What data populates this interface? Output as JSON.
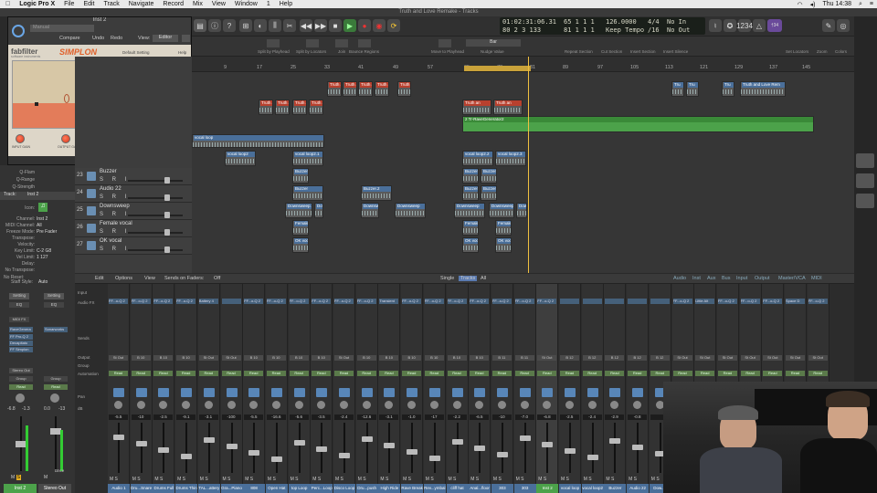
{
  "menubar": {
    "app_name": "Logic Pro X",
    "items": [
      "File",
      "Edit",
      "Track",
      "Navigate",
      "Record",
      "Mix",
      "View",
      "Window",
      "1",
      "Help"
    ],
    "clock": "Thu 14:38"
  },
  "window_title": "Truth and Love Remake - Tracks",
  "lcd": {
    "time_top": "01:02:31:06.31",
    "time_bottom": "80  2  3  133",
    "bar_top": "65  1  1  1",
    "bar_bottom": "81  1  1  1",
    "tempo": "126.0000",
    "tempo_mode": "Keep Tempo",
    "sig_top": "4/4",
    "sig_bottom": "/16",
    "in": "No In",
    "out": "No Out"
  },
  "controlbar": {
    "cpu_badge": "†34"
  },
  "toolbar": {
    "left_labels": [
      "Split by Playhead",
      "Split by Locators",
      "Join",
      "Bounce Regions"
    ],
    "mid_labels": [
      "Move to Playhead",
      "Nudge Value"
    ],
    "nudge_value": "Bar",
    "right_labels": [
      "Repeat Section",
      "Cut Section",
      "Insert Section",
      "Insert Silence",
      "Set Locators",
      "Zoom",
      "Colors"
    ],
    "snap_label": "Snap:",
    "snap_value": "Smart",
    "drag_label": "Drag:",
    "drag_value": "Overlap"
  },
  "plugin": {
    "window_title": "Inst 2",
    "preset": "Manual",
    "header_buttons": [
      "Compare",
      "Undo",
      "Redo"
    ],
    "view_label": "View:",
    "view_value": "Editor",
    "brand": "fabfilter",
    "brand_sub": "software instruments",
    "product": "SIMPLON",
    "default_setting": "Default Setting",
    "help": "Help",
    "combo_label": "Combo",
    "frequency_label": "FREQUENCY",
    "peak_label": "PEAK",
    "key_follow_label": "KEYBD TRACK",
    "combo_label2": "Combo",
    "input_label": "INPUT GAIN",
    "output_label": "OUTPUT GAIN",
    "mix_label": "DRY/WET MIX",
    "learn": "Learn",
    "midi_learn": "MIDI LEARN",
    "footer": "FF Simplon"
  },
  "inspector": {
    "top_rows": [
      "Q-Flam",
      "Q-Range",
      "Q-Strength"
    ],
    "track_label": "Track:",
    "track_name": "Inst 2",
    "rows": [
      {
        "k": "Icon:",
        "v": ""
      },
      {
        "k": "Channel:",
        "v": "Inst 2"
      },
      {
        "k": "MIDI Channel:",
        "v": "All"
      },
      {
        "k": "Freeze Mode:",
        "v": "Pre Fader"
      },
      {
        "k": "Transpose:",
        "v": ""
      },
      {
        "k": "Velocity:",
        "v": ""
      },
      {
        "k": "Key Limit:",
        "v": "C-2  G8"
      },
      {
        "k": "Vel Limit:",
        "v": "1  127"
      },
      {
        "k": "Delay:",
        "v": ""
      },
      {
        "k": "No Transpose:",
        "v": ""
      },
      {
        "k": "No Reset:",
        "v": ""
      },
      {
        "k": "Staff Style:",
        "v": "Auto"
      }
    ],
    "articulation": "Articulation Set:"
  },
  "tracks": [
    {
      "num": "23",
      "name": "Buzzer"
    },
    {
      "num": "24",
      "name": "Audio 22"
    },
    {
      "num": "25",
      "name": "Downsweep"
    },
    {
      "num": "26",
      "name": "Female vocal"
    },
    {
      "num": "27",
      "name": "OK vocal"
    }
  ],
  "track_buttons": "S R I",
  "ruler": [
    "9",
    "17",
    "25",
    "33",
    "41",
    "49",
    "57",
    "65",
    "73",
    "81",
    "89",
    "97",
    "105",
    "113",
    "121",
    "129",
    "137",
    "145"
  ],
  "regions": {
    "truth": "Truth and Love Rem",
    "truth_short": "Truth an",
    "tru": "Tru",
    "rave": "2 Tr-RaveGenerator2",
    "vocal_loop": "vocal loop",
    "vocal_loop2": "vocal loop2",
    "vocal_loop22": "vocal loop2.2",
    "vocal_loop23": "vocal loop2.3",
    "vocal_loop21": "vocal loop2.1",
    "buzzer": "Buzzer",
    "buzzer3": "Buzzer.3",
    "buzzer4": "Buzzer.4",
    "buzzer2": "Buzzer.2",
    "downsweep": "Downsweep",
    "downsweep1": "Downsweep.1",
    "downsweep6": "Downsweep.6",
    "female": "Female",
    "ok": "OK voc"
  },
  "mixer": {
    "menu": [
      "Edit",
      "Options",
      "View",
      "Sends on Faders:",
      "Off"
    ],
    "filters_center": [
      "Single",
      "Tracks",
      "All"
    ],
    "filters_right": [
      "Audio",
      "Inst",
      "Aux",
      "Bus",
      "Input",
      "Output",
      "Master/VCA",
      "MIDI"
    ],
    "row_labels": [
      "Input",
      "Audio FX",
      "Sends",
      "Output",
      "Group",
      "Automation",
      "Pan",
      "dB"
    ],
    "left_strip": {
      "setting": "Setting",
      "eq": "EQ",
      "midi_fx": "MIDI FX",
      "instrument": "RaveGenera",
      "plugins": [
        "FF Pro-Q 2",
        "Decapitato",
        "FF Simplon"
      ],
      "plugins2": [
        "Sonarworks"
      ],
      "output": "Stereo Out",
      "group": "Group",
      "read": "Read",
      "db_left": "-6.8",
      "db_left2": "-1.3",
      "db_right": "0.0",
      "db_right2": "-13",
      "bnce": "Bnce",
      "names": [
        "Inst 2",
        "Stereo Out"
      ]
    },
    "strips": [
      {
        "name": "Audio 1",
        "plug": "FF...o-Q 2",
        "out": "St Out",
        "db": "-5.5"
      },
      {
        "name": "Dru...Snare",
        "plug": "FF...o-Q 2",
        "out": "B 10",
        "db": "-10"
      },
      {
        "name": "Drums Full",
        "plug": "FF...o-Q 2",
        "out": "B 10",
        "db": "-2.5"
      },
      {
        "name": "Drums Thin",
        "plug": "FF...o-Q 2",
        "out": "B 10",
        "db": "-9.1"
      },
      {
        "name": "TAL...attery",
        "plug": "Battery 4",
        "out": "St Out",
        "db": "-3.1"
      },
      {
        "name": "Gra...Piano",
        "plug": "",
        "out": "St Out",
        "db": "-100"
      },
      {
        "name": "808",
        "plug": "FF...o-Q 2",
        "out": "B 10",
        "db": "-5.5"
      },
      {
        "name": "Open Hat",
        "plug": "FF...o-Q 2",
        "out": "B 10",
        "db": "-16.6"
      },
      {
        "name": "top Loop",
        "plug": "FF...o-Q 2",
        "out": "B 10",
        "db": "-5.6"
      },
      {
        "name": "Perc...Loop",
        "plug": "FF...o-Q 2",
        "out": "B 10",
        "db": "-3.5"
      },
      {
        "name": "Disco Loop",
        "plug": "FF...o-Q 2",
        "out": "St Out",
        "db": "-2.4"
      },
      {
        "name": "Dru...push",
        "plug": "FF...o-Q 2",
        "out": "B 10",
        "db": "-12.6"
      },
      {
        "name": "High Ride",
        "plug": "Transient",
        "out": "B 10",
        "db": "-3.1"
      },
      {
        "name": "Rave Break",
        "plug": "FF...o-Q 2",
        "out": "B 10",
        "db": "-1.0"
      },
      {
        "name": "Rev...ymbal",
        "plug": "FF...o-Q 2",
        "out": "B 10",
        "db": "-17"
      },
      {
        "name": "cliff hat",
        "plug": "FF...o-Q 2",
        "out": "B 10",
        "db": "-2.2"
      },
      {
        "name": "Anal...floor",
        "plug": "FF...o-Q 2",
        "out": "B 10",
        "db": "-6.5"
      },
      {
        "name": "303",
        "plug": "FF...o-Q 2",
        "out": "B 11",
        "db": "-10"
      },
      {
        "name": "303",
        "plug": "FF...o-Q 2",
        "out": "B 11",
        "db": "-7.0"
      },
      {
        "name": "Inst 2",
        "plug": "FF...o-Q 2",
        "out": "St Out",
        "db": "-6.8"
      },
      {
        "name": "vocal loop",
        "plug": "",
        "out": "B 12",
        "db": "-2.5"
      },
      {
        "name": "vocal loop2",
        "plug": "",
        "out": "B 12",
        "db": "-2.4"
      },
      {
        "name": "Buzzer",
        "plug": "",
        "out": "B 12",
        "db": "-2.9"
      },
      {
        "name": "Audio 22",
        "plug": "",
        "out": "B 12",
        "db": "-0.8"
      },
      {
        "name": "Dow...p",
        "plug": "",
        "out": "B 12",
        "db": ""
      },
      {
        "name": "",
        "plug": "FF...o-Q 2",
        "out": "St Out",
        "db": ""
      },
      {
        "name": "",
        "plug": "Little Alt",
        "out": "St Out",
        "db": ""
      },
      {
        "name": "",
        "plug": "FF...o-Q 2",
        "out": "St Out",
        "db": ""
      },
      {
        "name": "",
        "plug": "FF...o-Q 2",
        "out": "St Out",
        "db": ""
      },
      {
        "name": "",
        "plug": "FF...o-Q 2",
        "out": "St Out",
        "db": ""
      },
      {
        "name": "",
        "plug": "Space D",
        "out": "St Out",
        "db": ""
      },
      {
        "name": "",
        "plug": "FF...o-Q 2",
        "out": "St Out",
        "db": ""
      }
    ],
    "selected_strip_label": "Rav...nera",
    "read": "Read"
  }
}
